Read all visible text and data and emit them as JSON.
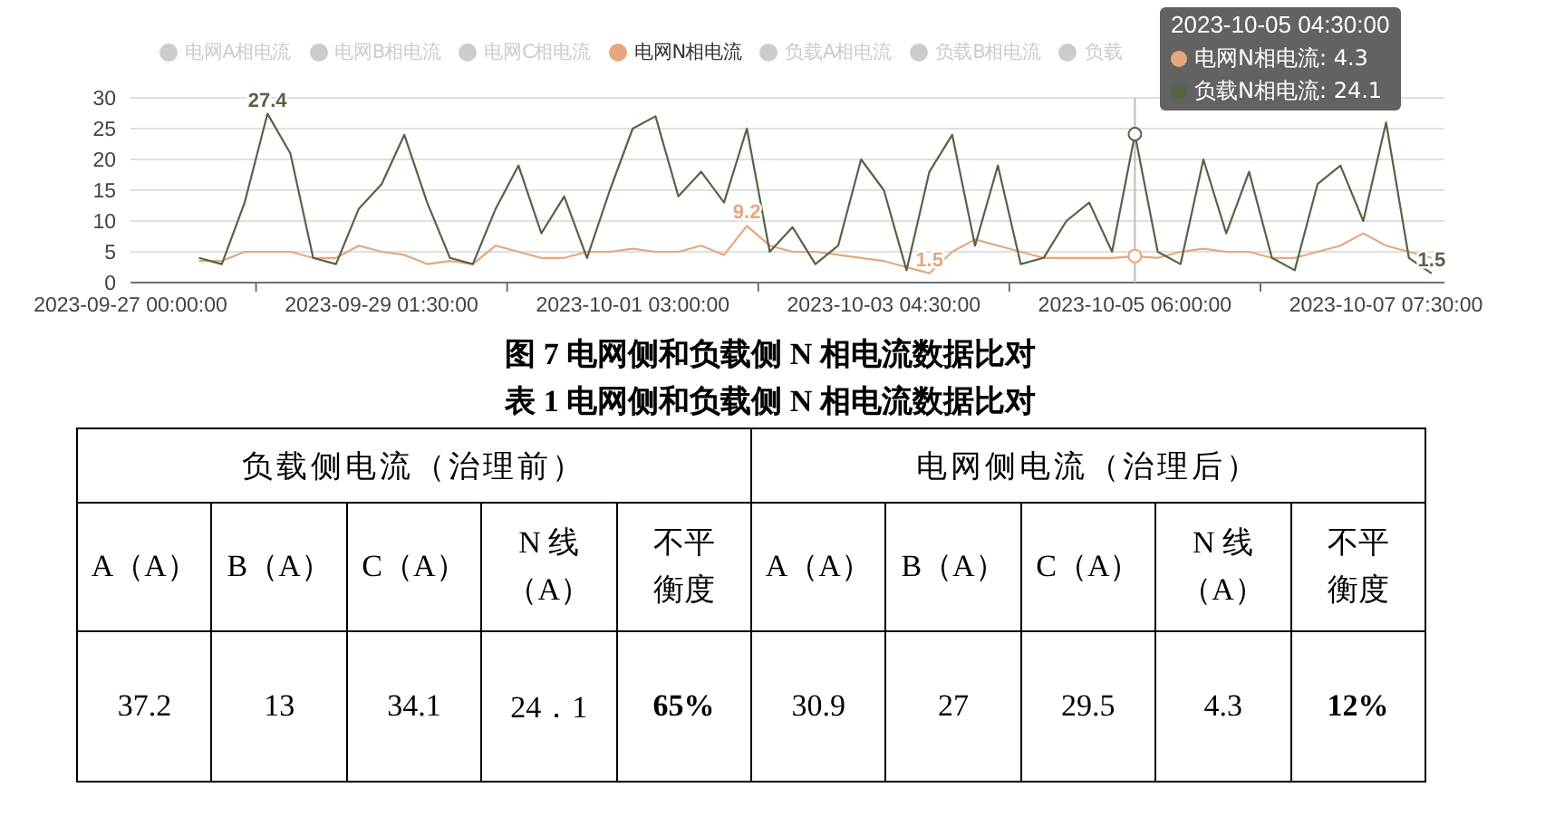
{
  "chart": {
    "legend": [
      {
        "label": "电网A相电流",
        "selected": false
      },
      {
        "label": "电网B相电流",
        "selected": false
      },
      {
        "label": "电网C相电流",
        "selected": false
      },
      {
        "label": "电网N相电流",
        "selected": true,
        "color": "#e6a77f"
      },
      {
        "label": "负载A相电流",
        "selected": false
      },
      {
        "label": "负载B相电流",
        "selected": false
      },
      {
        "label": "负载",
        "selected": false
      }
    ],
    "tooltip": {
      "title": "2023-10-05 04:30:00",
      "items": [
        {
          "label": "电网N相电流: 4.3",
          "color": "#e6a77f"
        },
        {
          "label": "负载N相电流: 24.1",
          "color": "#566446"
        }
      ]
    },
    "chart_data": {
      "type": "line",
      "categories": [
        "2023-09-27 00:00:00",
        null,
        null,
        null,
        null,
        null,
        null,
        null,
        null,
        null,
        null,
        "2023-09-29 01:30:00",
        null,
        null,
        null,
        null,
        null,
        null,
        null,
        null,
        null,
        null,
        "2023-10-01 03:00:00",
        null,
        null,
        null,
        null,
        null,
        null,
        null,
        null,
        null,
        null,
        "2023-10-03 04:30:00",
        null,
        null,
        null,
        null,
        null,
        null,
        null,
        null,
        null,
        null,
        "2023-10-05 06:00:00",
        null,
        null,
        null,
        null,
        null,
        null,
        null,
        null,
        null,
        null,
        "2023-10-07 07:30:00",
        null,
        null
      ],
      "ylim": [
        0,
        30
      ],
      "yticks": [
        0,
        5,
        10,
        15,
        20,
        25,
        30
      ],
      "series": [
        {
          "color": "#e6a77f",
          "values": [
            null,
            null,
            null,
            3.5,
            3.5,
            5,
            5,
            5,
            4,
            4,
            6,
            5,
            4.5,
            3,
            3.5,
            3,
            6,
            5,
            4,
            4,
            5,
            5,
            5.5,
            5,
            5,
            6,
            4.5,
            9.2,
            6,
            5,
            5,
            4.5,
            4,
            3.5,
            2.5,
            1.5,
            5,
            7,
            6,
            5,
            4,
            4,
            4,
            4,
            4.3,
            4,
            5,
            5.5,
            5,
            5,
            4,
            4,
            5,
            6,
            8,
            6,
            5,
            4
          ]
        },
        {
          "color": "#566446",
          "values": [
            null,
            null,
            null,
            4,
            3,
            13,
            27.4,
            21,
            4,
            3,
            12,
            16,
            24,
            13,
            4,
            3,
            12,
            19,
            8,
            14,
            4,
            15,
            25,
            27,
            14,
            18,
            13,
            25,
            5,
            9,
            3,
            6,
            20,
            15,
            2,
            18,
            24,
            6,
            19,
            3,
            4,
            10,
            13,
            5,
            24.1,
            5,
            3,
            20,
            8,
            18,
            4,
            2,
            16,
            19,
            10,
            26,
            4,
            1.5
          ]
        }
      ],
      "grid": true,
      "annotations": [
        {
          "y": 27.4,
          "text": "27.4"
        },
        {
          "y": 9.2,
          "text": "9.2"
        },
        {
          "y": 1.5,
          "text": "1.5"
        },
        {
          "y": 1.5,
          "text": "1.5"
        }
      ]
    }
  },
  "figure_caption": "图 7  电网侧和负载侧 N 相电流数据比对",
  "table_caption": "表 1  电网侧和负载侧 N 相电流数据比对",
  "table": {
    "groups": [
      {
        "label": "负载侧电流（治理前）"
      },
      {
        "label": "电网侧电流（治理后）"
      }
    ],
    "columns": [
      {
        "lines": [
          "A（A）"
        ]
      },
      {
        "lines": [
          "B（A）"
        ]
      },
      {
        "lines": [
          "C（A）"
        ]
      },
      {
        "lines": [
          "N 线",
          "（A）"
        ]
      },
      {
        "lines": [
          "不平",
          "衡度"
        ]
      },
      {
        "lines": [
          "A（A）"
        ]
      },
      {
        "lines": [
          "B（A）"
        ]
      },
      {
        "lines": [
          "C（A）"
        ]
      },
      {
        "lines": [
          "N 线",
          "（A）"
        ]
      },
      {
        "lines": [
          "不平",
          "衡度"
        ]
      }
    ],
    "rows": [
      [
        {
          "text": "37.2",
          "bold": false
        },
        {
          "text": "13",
          "bold": false
        },
        {
          "text": "34.1",
          "bold": false
        },
        {
          "text": "24．1",
          "bold": false
        },
        {
          "text": "65%",
          "bold": true
        },
        {
          "text": "30.9",
          "bold": false
        },
        {
          "text": "27",
          "bold": false
        },
        {
          "text": "29.5",
          "bold": false
        },
        {
          "text": "4.3",
          "bold": false
        },
        {
          "text": "12%",
          "bold": true
        }
      ]
    ]
  }
}
